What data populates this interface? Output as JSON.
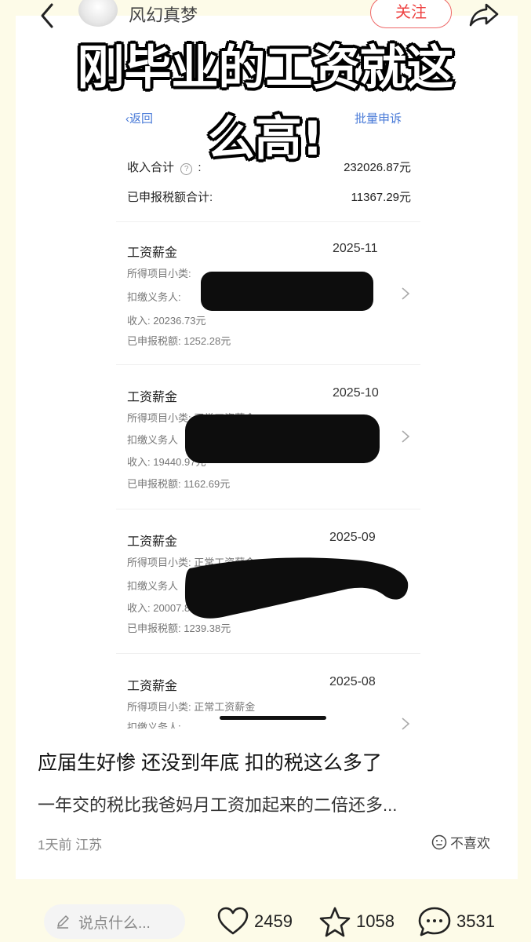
{
  "header": {
    "author": "风幻真梦",
    "follow_label": "关注"
  },
  "overlay": {
    "line1": "刚毕业的工资就这",
    "line2": "么高!"
  },
  "tax_app": {
    "back_label": "返回",
    "batch_label": "批量申诉",
    "income_total_label": "收入合计",
    "income_total_value": "232026.87元",
    "declared_total_label": "已申报税额合计:",
    "declared_total_value": "11367.29元",
    "records": [
      {
        "title": "工资薪金",
        "date": "2025-11",
        "subtype": "所得项目小类:",
        "payer": "扣缴义务人:",
        "income": "收入: 20236.73元",
        "tax": "已申报税额: 1252.28元"
      },
      {
        "title": "工资薪金",
        "date": "2025-10",
        "subtype": "所得项目小类: 正常工资薪金",
        "payer": "扣缴义务人",
        "income": "收入: 19440.97元",
        "tax": "已申报税额: 1162.69元"
      },
      {
        "title": "工资薪金",
        "date": "2025-09",
        "subtype": "所得项目小类: 正常工资薪金",
        "payer": "扣缴义务人",
        "income": "收入: 20007.80元",
        "tax": "已申报税额: 1239.38元"
      },
      {
        "title": "工资薪金",
        "date": "2025-08",
        "subtype": "所得项目小类: 正常工资薪金",
        "payer": "扣缴义务人:",
        "income": "",
        "tax": ""
      }
    ]
  },
  "post": {
    "title": "应届生好惨 还没到年底 扣的税这么多了",
    "body": "一年交的税比我爸妈月工资加起来的二倍还多...",
    "meta": "1天前 江苏",
    "dislike_label": "不喜欢"
  },
  "bottom_bar": {
    "comment_placeholder": "说点什么...",
    "likes": "2459",
    "favorites": "1058",
    "comments": "3531"
  },
  "colors": {
    "background": "#fdfbe8",
    "accent_blue": "#4a7bd8",
    "follow_red": "#e44"
  }
}
